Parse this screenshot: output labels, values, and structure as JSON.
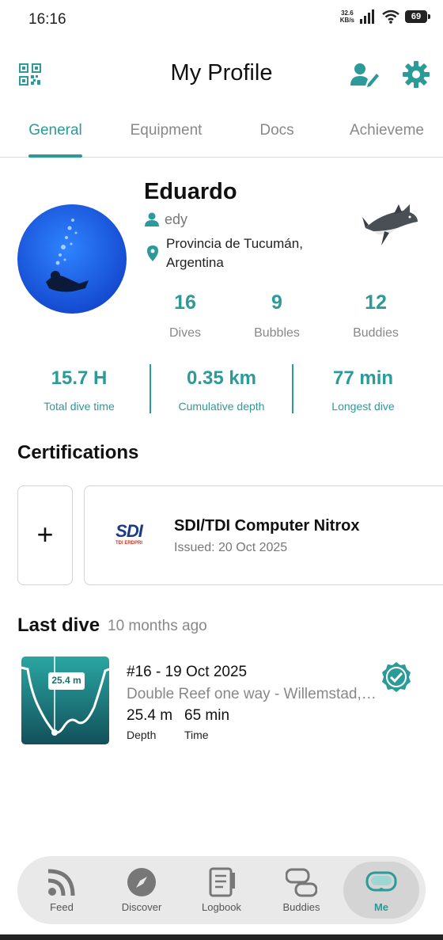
{
  "status_bar": {
    "time": "16:16",
    "speed_value": "32.6",
    "speed_unit": "KB/s",
    "battery": "69"
  },
  "header": {
    "title": "My Profile",
    "qr_icon": "qr-code-icon",
    "edit_icon": "edit-profile-icon",
    "settings_icon": "gear-icon"
  },
  "tabs": [
    {
      "label": "General",
      "active": true
    },
    {
      "label": "Equipment"
    },
    {
      "label": "Docs"
    },
    {
      "label": "Achieveme"
    }
  ],
  "profile": {
    "name": "Eduardo",
    "username": "edy",
    "location_line1": "Provincia de Tucumán,",
    "location_line2": "Argentina",
    "badge_icon": "shark-icon",
    "stats": [
      {
        "value": "16",
        "label": "Dives"
      },
      {
        "value": "9",
        "label": "Bubbles"
      },
      {
        "value": "12",
        "label": "Buddies"
      }
    ],
    "highlights": [
      {
        "value": "15.7 H",
        "label": "Total dive time"
      },
      {
        "value": "0.35 km",
        "label": "Cumulative depth"
      },
      {
        "value": "77 min",
        "label": "Longest dive"
      }
    ]
  },
  "certifications": {
    "title": "Certifications",
    "add_label": "+",
    "items": [
      {
        "logo_text": "SDI",
        "logo_subtext": "TDI ERDPRI",
        "name": "SDI/TDI Computer Nitrox",
        "issued": "Issued: 20 Oct 2025"
      }
    ]
  },
  "last_dive": {
    "title": "Last dive",
    "ago": "10 months ago",
    "profile_depth_label": "25.4 m",
    "dive_title": "#16 - 19 Oct 2025",
    "site": "Double Reef one way - Willemstad, Curaçao",
    "depth_value": "25.4 m",
    "depth_label": "Depth",
    "time_value": "65 min",
    "time_label": "Time",
    "verified_icon": "verified-check-icon"
  },
  "bottom_nav": [
    {
      "label": "Feed",
      "icon": "rss-feed-icon"
    },
    {
      "label": "Discover",
      "icon": "compass-icon"
    },
    {
      "label": "Logbook",
      "icon": "notebook-icon"
    },
    {
      "label": "Buddies",
      "icon": "dive-masks-icon"
    },
    {
      "label": "Me",
      "icon": "dive-mask-icon",
      "active": true
    }
  ],
  "colors": {
    "accent": "#2b9a98",
    "muted": "#888888"
  }
}
